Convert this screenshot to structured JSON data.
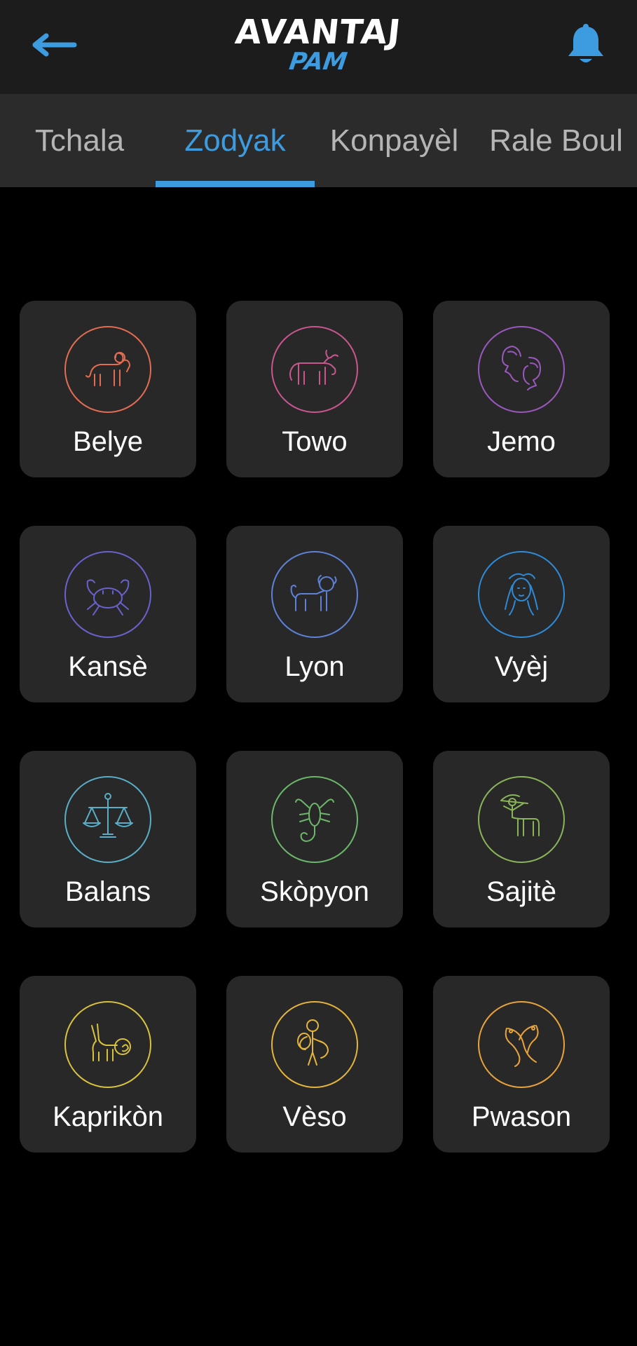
{
  "app_bar": {
    "logo_main": "AVANTAJ",
    "logo_sub": "PAM",
    "back_icon": "arrow-left-icon",
    "notification_icon": "bell-icon",
    "accent_color": "#3d9be0"
  },
  "tabs": [
    {
      "label": "Tchala",
      "active": false
    },
    {
      "label": "Zodyak",
      "active": true
    },
    {
      "label": "Konpayèl",
      "active": false
    },
    {
      "label": "Rale Boul",
      "active": false
    }
  ],
  "signs": [
    {
      "name": "Belye",
      "icon": "aries-ram-icon",
      "color": "#e26d52"
    },
    {
      "name": "Towo",
      "icon": "taurus-bull-icon",
      "color": "#c9568e"
    },
    {
      "name": "Jemo",
      "icon": "gemini-twins-icon",
      "color": "#9a58bd"
    },
    {
      "name": "Kansè",
      "icon": "cancer-crab-icon",
      "color": "#6a62cc"
    },
    {
      "name": "Lyon",
      "icon": "leo-lion-icon",
      "color": "#5d82d8"
    },
    {
      "name": "Vyèj",
      "icon": "virgo-maiden-icon",
      "color": "#2f8ad6"
    },
    {
      "name": "Balans",
      "icon": "libra-scales-icon",
      "color": "#5aaec7"
    },
    {
      "name": "Skòpyon",
      "icon": "scorpio-scorpion-icon",
      "color": "#6cb86a"
    },
    {
      "name": "Sajitè",
      "icon": "sagittarius-archer-icon",
      "color": "#8ab45a"
    },
    {
      "name": "Kaprikòn",
      "icon": "capricorn-goat-icon",
      "color": "#d8c23e"
    },
    {
      "name": "Vèso",
      "icon": "aquarius-water-bearer-icon",
      "color": "#e5b53b"
    },
    {
      "name": "Pwason",
      "icon": "pisces-fish-icon",
      "color": "#e8a43a"
    }
  ]
}
